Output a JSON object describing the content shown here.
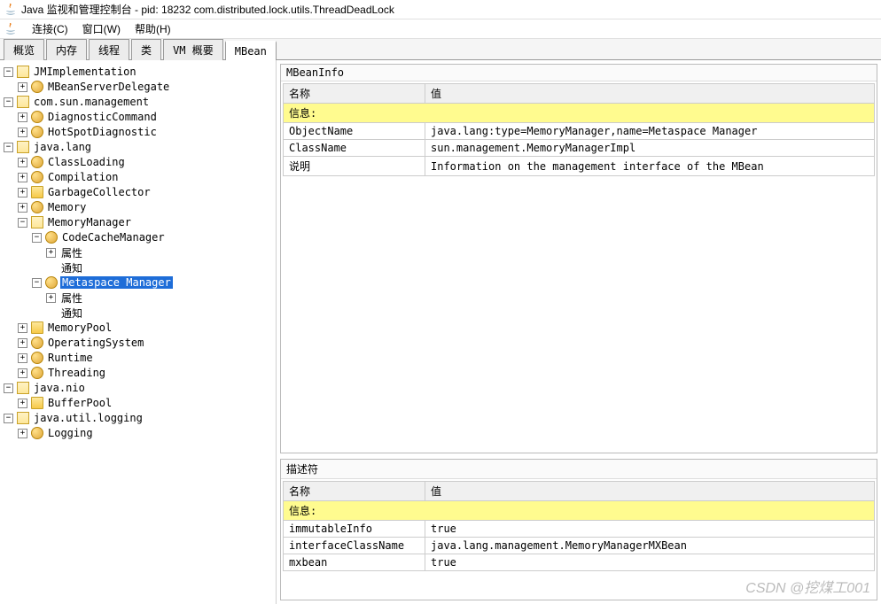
{
  "window": {
    "title": "Java 监视和管理控制台 - pid: 18232 com.distributed.lock.utils.ThreadDeadLock"
  },
  "menu": {
    "connect": "连接(C)",
    "window": "窗口(W)",
    "help": "帮助(H)"
  },
  "tabs": {
    "overview": "概览",
    "memory": "内存",
    "threads": "线程",
    "classes": "类",
    "vm": "VM 概要",
    "mbean": "MBean"
  },
  "tree": {
    "jmimpl": "JMImplementation",
    "mbeansrv": "MBeanServerDelegate",
    "comsun": "com.sun.management",
    "diagcmd": "DiagnosticCommand",
    "hotspot": "HotSpotDiagnostic",
    "javalang": "java.lang",
    "classloading": "ClassLoading",
    "compilation": "Compilation",
    "gc": "GarbageCollector",
    "memory": "Memory",
    "memmgr": "MemoryManager",
    "codecache": "CodeCacheManager",
    "attr": "属性",
    "notif": "通知",
    "metaspace": "Metaspace Manager",
    "mempool": "MemoryPool",
    "os": "OperatingSystem",
    "runtime": "Runtime",
    "threading": "Threading",
    "javanio": "java.nio",
    "bufferpool": "BufferPool",
    "javalog": "java.util.logging",
    "logging": "Logging"
  },
  "mbeaninfo": {
    "title": "MBeanInfo",
    "col_name": "名称",
    "col_value": "值",
    "group_info": "信息:",
    "rows": [
      {
        "name": "ObjectName",
        "value": "java.lang:type=MemoryManager,name=Metaspace Manager"
      },
      {
        "name": "ClassName",
        "value": "sun.management.MemoryManagerImpl"
      },
      {
        "name": "说明",
        "value": "Information on the management interface of the MBean"
      }
    ]
  },
  "descriptor": {
    "title": "描述符",
    "col_name": "名称",
    "col_value": "值",
    "group_info": "信息:",
    "rows": [
      {
        "name": "immutableInfo",
        "value": "true"
      },
      {
        "name": "interfaceClassName",
        "value": "java.lang.management.MemoryManagerMXBean"
      },
      {
        "name": "mxbean",
        "value": "true"
      }
    ]
  },
  "watermark": "CSDN @挖煤工001"
}
